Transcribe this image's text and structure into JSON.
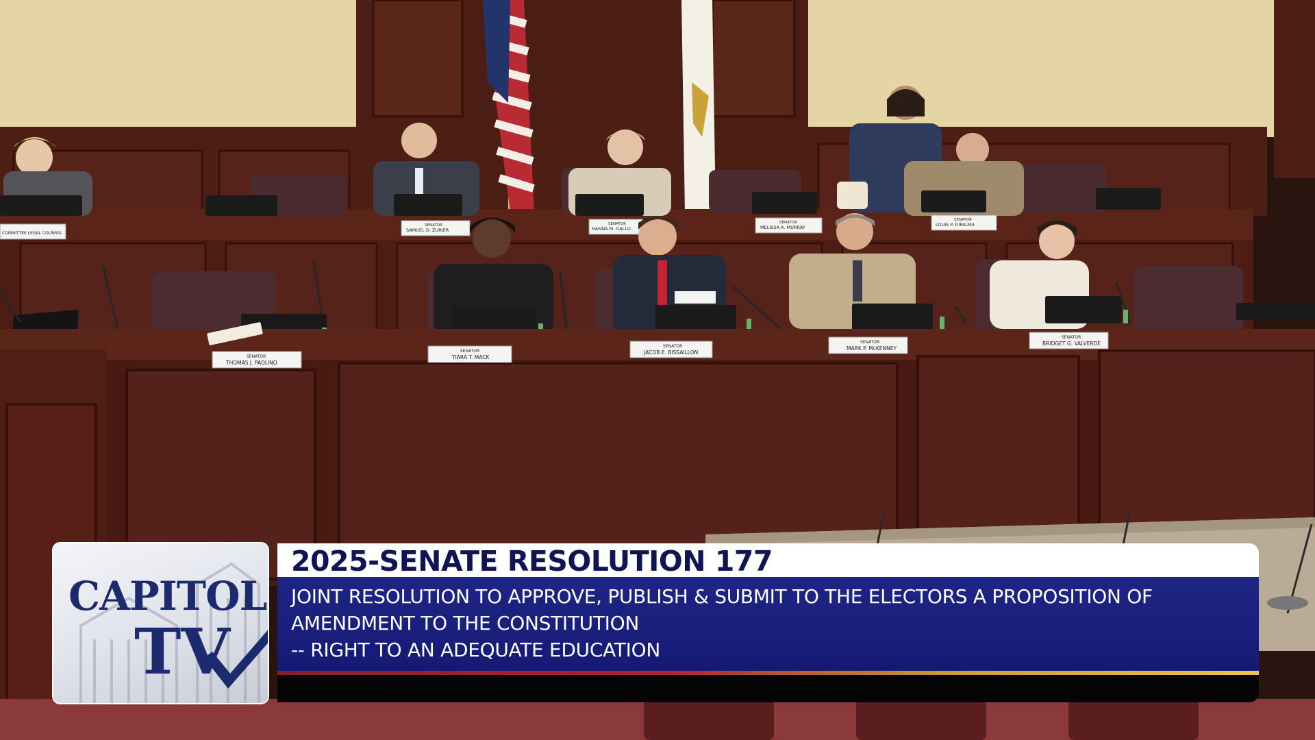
{
  "nameplates": {
    "committee_legal_counsel": "COMMITTEE LEGAL COUNSEL",
    "zurier": {
      "role": "SENATOR",
      "name": "SAMUEL D. ZURIER"
    },
    "gallo": {
      "role": "SENATOR",
      "name": "HANNA M. GALLO"
    },
    "murray": {
      "role": "SENATOR",
      "name": "MELISSA A. MURRAY"
    },
    "dipalma": {
      "role": "SENATOR",
      "name": "LOUIS P. DIPALMA"
    },
    "paolino": {
      "role": "SENATOR",
      "name": "THOMAS J. PAOLINO"
    },
    "mack": {
      "role": "SENATOR",
      "name": "TIARA T. MACK"
    },
    "bissaillon": {
      "role": "SENATOR",
      "name": "JACOB E. BISSAILLON"
    },
    "mckenney": {
      "role": "SENATOR",
      "name": "MARK P. McKENNEY"
    },
    "valverde": {
      "role": "SENATOR",
      "name": "BRIDGET G. VALVERDE"
    }
  },
  "overlay": {
    "logo_word": "CAPITOL",
    "logo_tv": "TV",
    "title": "2025-SENATE RESOLUTION 177",
    "description_lines": [
      "JOINT RESOLUTION TO APPROVE, PUBLISH & SUBMIT TO THE ELECTORS A PROPOSITION OF",
      "AMENDMENT TO THE CONSTITUTION",
      "-- RIGHT TO AN ADEQUATE EDUCATION"
    ],
    "colors": {
      "title_text": "#0e1552",
      "desc_bg": "#1a2080",
      "stripe_red": "#b0242a",
      "stripe_gold": "#e9c552"
    }
  }
}
